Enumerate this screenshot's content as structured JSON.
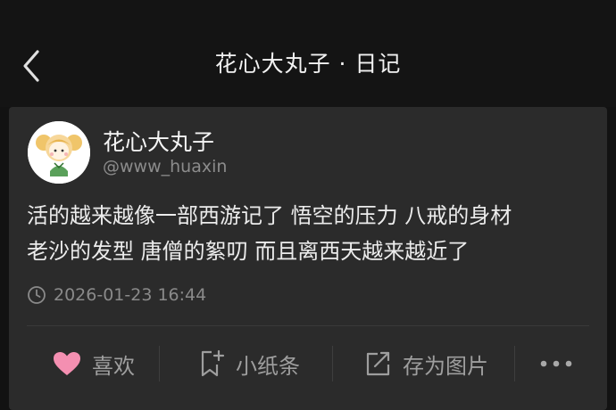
{
  "header": {
    "title": "花心大丸子 · 日记"
  },
  "post": {
    "author_name": "花心大丸子",
    "author_handle": "@www_huaxin",
    "content_lines": [
      "活的越来越像一部西游记了 悟空的压力 八戒的身材",
      "老沙的发型 唐僧的絮叨 而且离西天越来越近了"
    ],
    "timestamp": "2026-01-23 16:44"
  },
  "actions": {
    "like_label": "喜欢",
    "note_label": "小纸条",
    "save_image_label": "存为图片"
  },
  "colors": {
    "background": "#121212",
    "card": "#2b2b2b",
    "like_heart": "#f48fb1",
    "text_secondary": "#8c8c8c"
  },
  "icons": {
    "back": "chevron-left-icon",
    "clock": "clock-icon",
    "like": "heart-icon",
    "note": "bookmark-plus-icon",
    "save_image": "share-export-icon",
    "more": "more-dots-icon"
  }
}
